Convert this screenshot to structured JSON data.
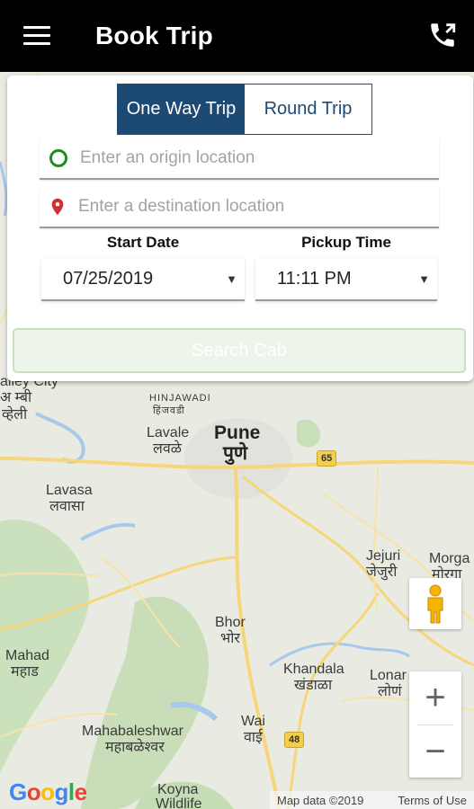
{
  "appbar": {
    "title": "Book Trip",
    "menu_icon": "hamburger-menu-icon",
    "call_icon": "call-forward-icon"
  },
  "trip_type": {
    "one_way": "One Way Trip",
    "round_trip": "Round Trip",
    "selected": "one_way"
  },
  "origin": {
    "placeholder": "Enter an origin location",
    "value": ""
  },
  "destination": {
    "placeholder": "Enter a destination location",
    "value": ""
  },
  "start_date": {
    "label": "Start Date",
    "value": "07/25/2019"
  },
  "pickup_time": {
    "label": "Pickup Time",
    "value": "11:11 PM"
  },
  "search_button": "Search Cab",
  "map": {
    "labels": {
      "valley_city": "alley City",
      "aamby_mr": "अ म्बी",
      "valley_mr": "व्हेली",
      "hinjawadi": "HINJAWADI",
      "hinjawadi_mr": "हिंजवडी",
      "lavale": "Lavale",
      "lavale_mr": "लवळे",
      "pune": "Pune",
      "pune_mr": "पुणे",
      "lavasa": "Lavasa",
      "lavasa_mr": "लवासा",
      "jejuri": "Jejuri",
      "jejuri_mr": "जेजुरी",
      "morgaon": "Morga",
      "morgaon_mr": "मोरगा",
      "bhor": "Bhor",
      "bhor_mr": "भोर",
      "mahad": "Mahad",
      "mahad_mr": "महाड",
      "khandala": "Khandala",
      "khandala_mr": "खंडाळा",
      "lonand": "Lonar",
      "lonand_mr": "लोणं",
      "mahabaleshwar": "Mahabaleshwar",
      "mahabaleshwar_mr": "महाबळेश्वर",
      "wai": "Wai",
      "wai_mr": "वाई",
      "koyna": "Koyna",
      "koyna2": "Wildlife",
      "hwy_65": "65",
      "hwy_48": "48"
    },
    "google": "Google",
    "map_data": "Map data ©2019",
    "terms": "Terms of Use",
    "zoom_in": "+",
    "zoom_out": "−"
  }
}
